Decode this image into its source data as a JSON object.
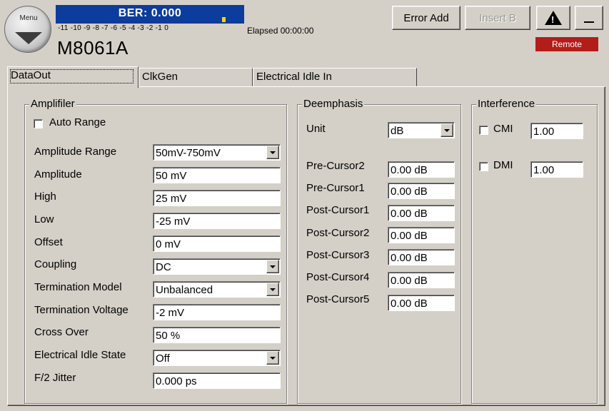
{
  "header": {
    "menu_label": "Menu",
    "ber_text": "BER: 0.000",
    "ber_scale": "-11 -10  -9  -8  -7  -6  -5  -4  -3  -2  -1   0",
    "elapsed": "Elapsed 00:00:00",
    "model": "M8061A",
    "error_add_label": "Error Add",
    "insert_b_label": "Insert B",
    "remote_label": "Remote",
    "colors": {
      "ber_bg": "#0c3c9c",
      "remote_bg": "#b31d19"
    }
  },
  "tabs": [
    {
      "label": "DataOut",
      "active": true
    },
    {
      "label": "ClkGen",
      "active": false
    },
    {
      "label": "Electrical Idle In",
      "active": false
    }
  ],
  "amplifier": {
    "title": "Amplifiler",
    "auto_range_label": "Auto Range",
    "auto_range_checked": false,
    "rows": [
      {
        "label": "Amplitude Range",
        "value": "50mV-750mV",
        "type": "combo"
      },
      {
        "label": "Amplitude",
        "value": "50 mV",
        "type": "text"
      },
      {
        "label": "High",
        "value": "25 mV",
        "type": "text"
      },
      {
        "label": "Low",
        "value": "-25 mV",
        "type": "text"
      },
      {
        "label": "Offset",
        "value": "0 mV",
        "type": "text"
      },
      {
        "label": "Coupling",
        "value": "DC",
        "type": "combo"
      },
      {
        "label": "Termination Model",
        "value": "Unbalanced",
        "type": "combo"
      },
      {
        "label": "Termination Voltage",
        "value": "-2 mV",
        "type": "text"
      },
      {
        "label": "Cross Over",
        "value": "50 %",
        "type": "text"
      },
      {
        "label": "Electrical Idle State",
        "value": "Off",
        "type": "combo"
      },
      {
        "label": "F/2 Jitter",
        "value": "0.000 ps",
        "type": "text"
      }
    ]
  },
  "deemphasis": {
    "title": "Deemphasis",
    "unit_label": "Unit",
    "unit_value": "dB",
    "rows": [
      {
        "label": "Pre-Cursor2",
        "value": "0.00 dB"
      },
      {
        "label": "Pre-Cursor1",
        "value": "0.00 dB"
      },
      {
        "label": "Post-Cursor1",
        "value": "0.00 dB"
      },
      {
        "label": "Post-Cursor2",
        "value": "0.00 dB"
      },
      {
        "label": "Post-Cursor3",
        "value": "0.00 dB"
      },
      {
        "label": "Post-Cursor4",
        "value": "0.00 dB"
      },
      {
        "label": "Post-Cursor5",
        "value": "0.00 dB"
      }
    ]
  },
  "interference": {
    "title": "Interference",
    "cmi_label": "CMI",
    "cmi_checked": false,
    "cmi_value": "1.00",
    "dmi_label": "DMI",
    "dmi_checked": false,
    "dmi_value": "1.00"
  }
}
